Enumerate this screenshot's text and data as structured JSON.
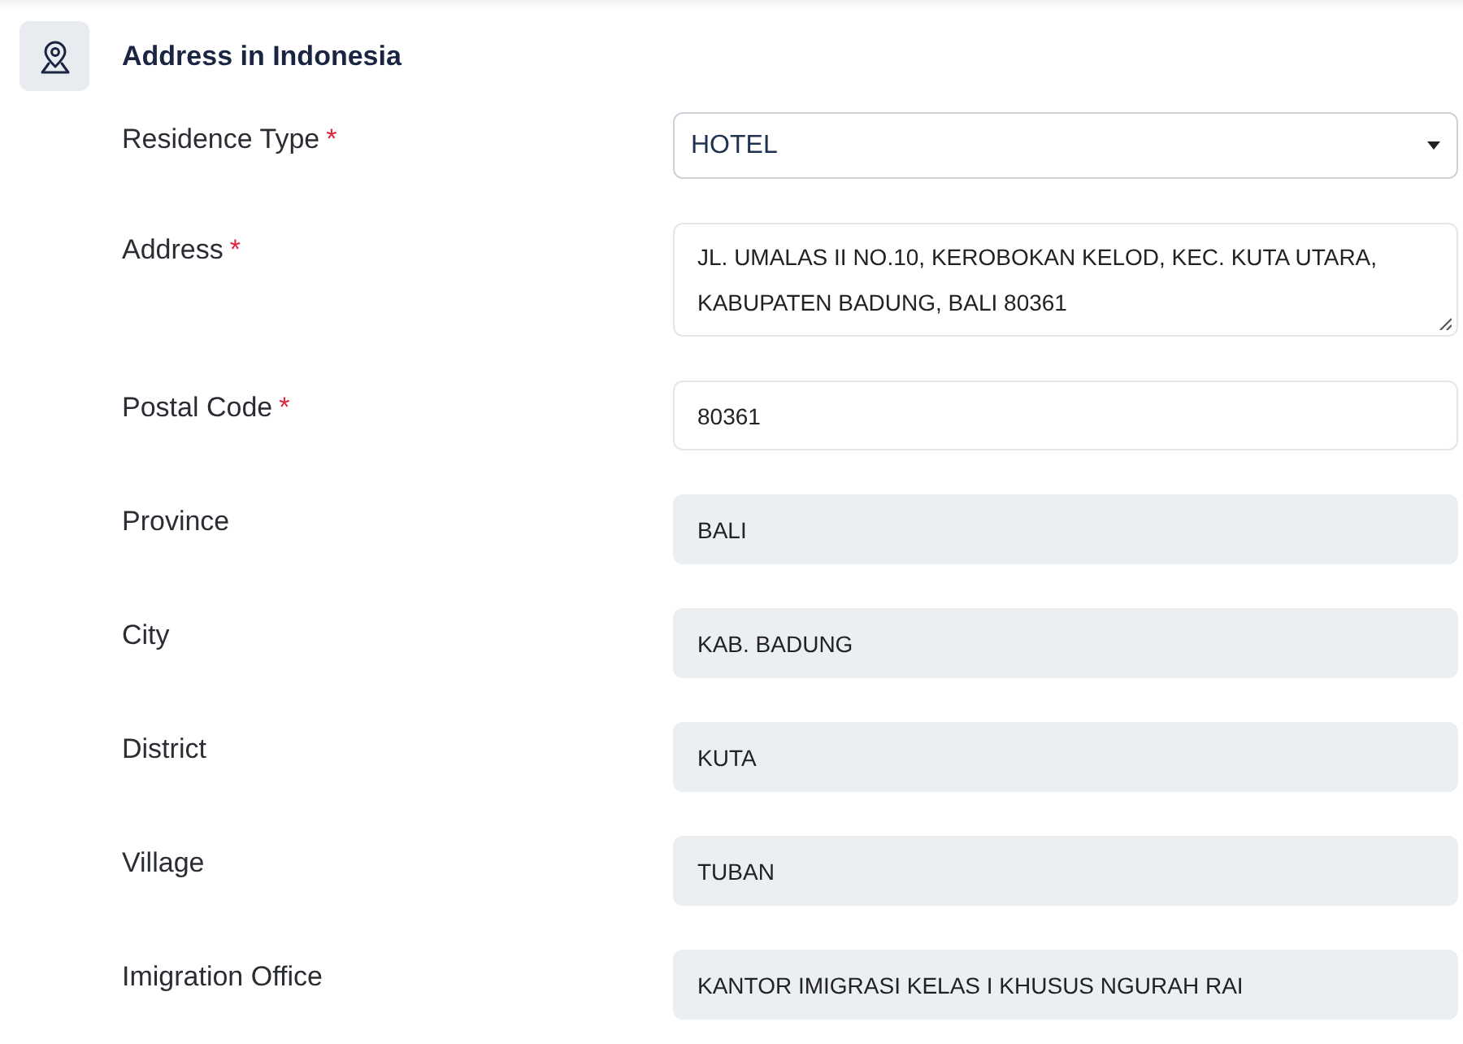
{
  "section": {
    "title": "Address in Indonesia"
  },
  "fields": [
    {
      "label": "Residence Type",
      "required_mark": "*",
      "kind": "select",
      "value": "HOTEL",
      "disabled": false
    },
    {
      "label": "Address",
      "required_mark": "*",
      "kind": "textarea",
      "value": "JL. UMALAS II NO.10, KEROBOKAN KELOD, KEC. KUTA UTARA, KABUPATEN BADUNG, BALI 80361",
      "disabled": false
    },
    {
      "label": "Postal Code",
      "required_mark": "*",
      "kind": "text",
      "value": "80361",
      "disabled": false
    },
    {
      "label": "Province",
      "kind": "text",
      "value": "BALI",
      "disabled": true
    },
    {
      "label": "City",
      "kind": "text",
      "value": "KAB. BADUNG",
      "disabled": true
    },
    {
      "label": "District",
      "kind": "text",
      "value": "KUTA",
      "disabled": true
    },
    {
      "label": "Village",
      "kind": "text",
      "value": "TUBAN",
      "disabled": true
    },
    {
      "label": "Imigration Office",
      "kind": "text",
      "value": "KANTOR IMIGRASI KELAS I KHUSUS NGURAH RAI",
      "disabled": true
    }
  ]
}
